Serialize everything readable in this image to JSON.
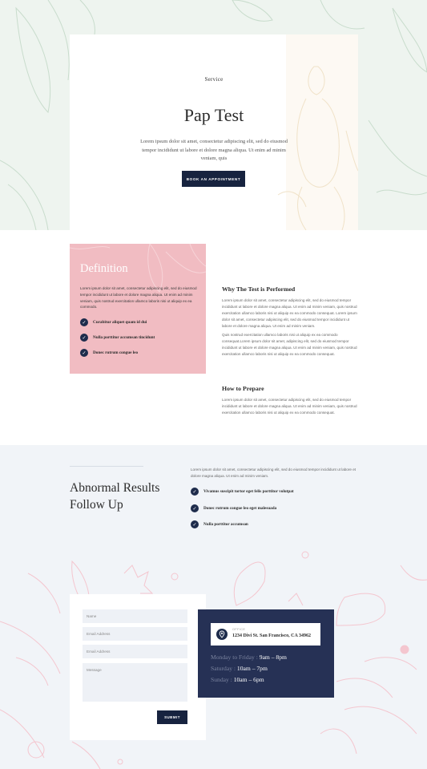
{
  "hero": {
    "eyebrow": "Service",
    "title": "Pap Test",
    "text": "Lorem ipsum dolor sit amet, consectetur adipiscing elit, sed do eiusmod tempor incididunt ut labore et dolore magna aliqua. Ut enim ad minim veniam, quis",
    "button": "BOOK AN APPOINTMENT"
  },
  "definition": {
    "title": "Definition",
    "text": "Lorem ipsum dolor sit amet, consectetur adipiscing elit, sed do eiusmod tempor incididunt ut labore et dolore magna aliqua. Ut enim ad minim veniam, quis nostrud exercitation ullamco laboris nisi ut aliquip ex ea commodo.",
    "checks": [
      "Curabitur aliquet quam id dui",
      "Nulla porttitor accumsan tincidunt",
      "Donec rutrum congue leo"
    ]
  },
  "why": {
    "title": "Why The Test is Performed",
    "p1": "Lorem ipsum dolor sit amet, consectetur adipiscing elit, sed do eiusmod tempor incididunt ut labore et dolore magna aliqua. Ut enim ad minim veniam, quis nostrud exercitation ullamco laboris nisi ut aliquip ex ea commodo consequat. Lorem ipsum dolor sit amet, consectetur adipiscing elit, sed do eiusmod tempor incididunt ut labore et dolore magna aliqua. Ut enim ad minim veniam.",
    "p2": "Quis nostrud exercitation ullamco laboris nisi ut aliquip ex ea commodo consequat.Lorem ipsum dolor sit amet, adipiscing elit, sed do eiusmod tempor incididunt ut labore et dolore magna aliqua. Ut enim ad minim veniam, quis nostrud exercitation ullamco laboris nisi ut aliquip ex ea commodo consequat."
  },
  "prepare": {
    "title": "How to Prepare",
    "text": "Lorem ipsum dolor sit amet, consectetur adipiscing elit, sed do eiusmod tempor incididunt ut labore et dolore magna aliqua. Ut enim ad minim veniam, quis nostrud exercitation ullamco laboris nisi ut aliquip ex ea commodo consequat."
  },
  "abnormal": {
    "title": "Abnormal Results Follow Up",
    "text": "Lorem ipsum dolor sit amet, consectetur adipiscing elit, sed do eiusmod tempor incididunt ut labore et dolore magna aliqua. Ut enim ad minim veniam.",
    "checks": [
      "Vivamus suscipit tortor eget felis porttitor volutpat",
      "Donec rutrum congue leo eget malesuada",
      "Nulla porttitor accumsan"
    ]
  },
  "form": {
    "name_placeholder": "Name",
    "email_placeholder": "Email Address",
    "email2_placeholder": "Email Address",
    "message_placeholder": "Message",
    "submit": "SUBMIT"
  },
  "office": {
    "tag": "OFFICE",
    "address": "1234 Divi St. San Francisco, CA 34962",
    "hours": [
      {
        "days": "Monday to Friday :",
        "time": "9am – 8pm"
      },
      {
        "days": "Saturday :",
        "time": "10am – 7pm"
      },
      {
        "days": "Sunday :",
        "time": "10am – 6pm"
      }
    ]
  },
  "colors": {
    "navy": "#17233f",
    "pink": "#f1bcc2",
    "office_bg": "#263155",
    "hero_bg": "#eef4ef",
    "section_bg": "#f1f4f8"
  },
  "icons": [
    "check-icon",
    "location-pin-icon",
    "leaf-decoration-icon"
  ]
}
